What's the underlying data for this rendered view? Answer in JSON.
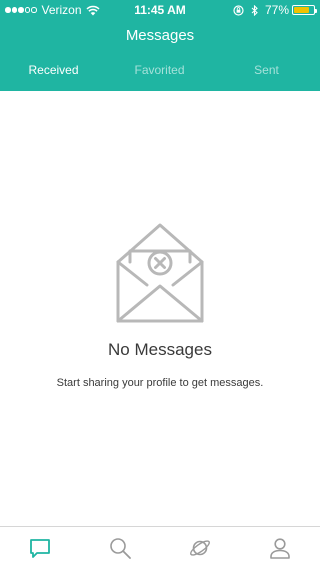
{
  "status_bar": {
    "carrier": "Verizon",
    "time": "11:45 AM",
    "battery": "77%",
    "battery_level": 0.77,
    "signal_bars": 3,
    "signal_total": 5,
    "icons": [
      "wifi-icon",
      "orientation-lock-icon",
      "bluetooth-icon",
      "battery-icon"
    ]
  },
  "nav": {
    "title": "Messages"
  },
  "tabs": [
    {
      "label": "Received",
      "active": true
    },
    {
      "label": "Favorited",
      "active": false
    },
    {
      "label": "Sent",
      "active": false
    }
  ],
  "empty_state": {
    "icon": "envelope-x-icon",
    "title": "No Messages",
    "subtitle": "Start sharing your profile to get messages."
  },
  "tab_bar": {
    "items": [
      {
        "icon": "chat-bubble-icon",
        "active": true
      },
      {
        "icon": "search-icon",
        "active": false
      },
      {
        "icon": "planet-icon",
        "active": false
      },
      {
        "icon": "profile-icon",
        "active": false
      }
    ]
  },
  "colors": {
    "brand": "#1fb5a2",
    "battery": "#f2c200",
    "icon_inactive": "#9a9a9a",
    "icon_active": "#1fb5a2",
    "text": "#3a3a3a"
  }
}
